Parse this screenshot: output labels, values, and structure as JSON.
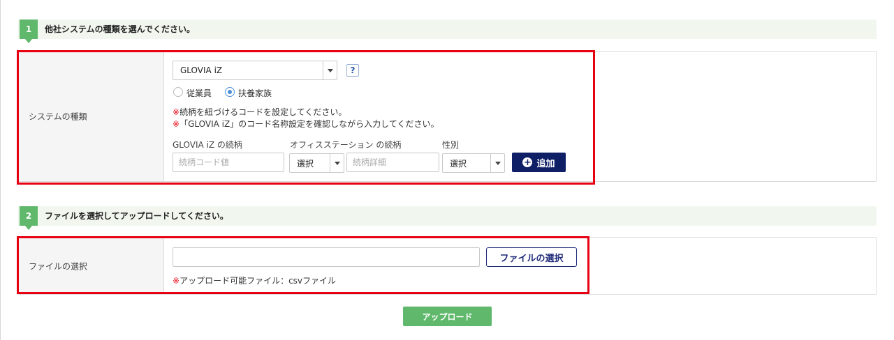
{
  "step1": {
    "number": "1",
    "title": "他社システムの種類を選んでください。"
  },
  "system": {
    "label": "システムの種類",
    "select_value": "GLOVIA iZ",
    "help": "?",
    "radios": [
      {
        "label": "従業員",
        "checked": false
      },
      {
        "label": "扶養家族",
        "checked": true
      }
    ],
    "notes": [
      {
        "mark": "※",
        "text": "続柄を紐づけるコードを設定してください。"
      },
      {
        "mark": "※",
        "text": "「GLOVIA iZ」のコード名称設定を確認しながら入力してください。"
      }
    ],
    "columns": {
      "glovia_label": "GLOVIA iZ の続柄",
      "office_label": "オフィスステーション の続柄",
      "gender_label": "性別"
    },
    "code_placeholder": "続柄コード値",
    "office_select": "選択",
    "detail_placeholder": "続柄詳細",
    "gender_select": "選択",
    "add_label": "追加",
    "add_icon": "plus-circle-icon"
  },
  "step2": {
    "number": "2",
    "title": "ファイルを選択してアップロードしてください。"
  },
  "file": {
    "label": "ファイルの選択",
    "path_value": "",
    "select_button": "ファイルの選択",
    "note_mark": "※",
    "note_text": "アップロード可能ファイル：csvファイル"
  },
  "upload_button": "アップロード",
  "colors": {
    "accent_green": "#5fb86b",
    "navy": "#0e1f66",
    "highlight_red": "#e60012"
  }
}
